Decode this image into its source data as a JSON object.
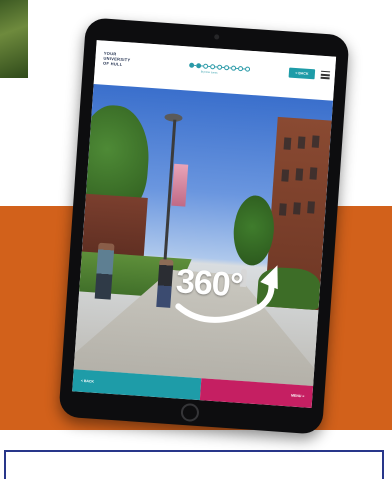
{
  "colors": {
    "orange_band": "#d2611b",
    "teal": "#1e9ca8",
    "magenta": "#c51f62",
    "box_border": "#28368a"
  },
  "app": {
    "logo_lines": [
      "YOUR",
      "UNIVERSITY",
      "OF HULL"
    ],
    "stepper": {
      "total_steps": 9,
      "current_step": 2,
      "caption": "Brynmor Jones"
    },
    "header_back_label": "< BACK",
    "menu_icon": "hamburger-icon"
  },
  "overlay": {
    "badge_text": "360°",
    "badge_icon": "rotate-arrow-icon"
  },
  "footer": {
    "back_label": "< BACK",
    "menu_label": "MENU ≡"
  }
}
